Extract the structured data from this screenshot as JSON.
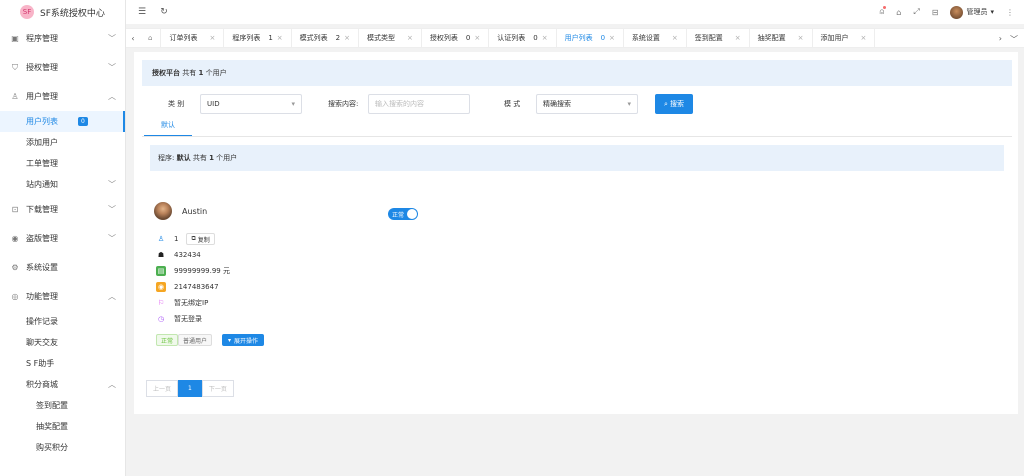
{
  "app": {
    "title": "SF系统授权中心",
    "logo_icon": "SF"
  },
  "colors": {
    "accent": "#1e88e5",
    "notice_bg": "#e8f1fb"
  },
  "sidebar": {
    "menus": [
      {
        "label": "程序管理",
        "icon": "app-icon",
        "arrow": "﹀"
      },
      {
        "label": "授权管理",
        "icon": "shield-icon",
        "arrow": "﹀"
      },
      {
        "label": "用户管理",
        "icon": "user-icon",
        "arrow": "︿"
      }
    ],
    "user_subs": [
      {
        "label": "用户列表",
        "count": "0"
      },
      {
        "label": "添加用户"
      },
      {
        "label": "工单管理"
      },
      {
        "label": "站内通知",
        "arrow": "﹀"
      }
    ],
    "menus2": [
      {
        "label": "下载管理",
        "icon": "download-icon",
        "arrow": "﹀"
      },
      {
        "label": "盗版管理",
        "icon": "pirate-icon",
        "arrow": "﹀"
      },
      {
        "label": "系统设置",
        "icon": "gear-icon"
      },
      {
        "label": "功能管理",
        "icon": "function-icon",
        "arrow": "︿"
      }
    ],
    "func_subs": [
      {
        "label": "操作记录"
      },
      {
        "label": "聊天交友"
      },
      {
        "label": "S F助手"
      },
      {
        "label": "积分商城",
        "arrow": "︿"
      }
    ],
    "mall_subs": [
      {
        "label": "签到配置"
      },
      {
        "label": "抽奖配置"
      },
      {
        "label": "购买积分"
      }
    ]
  },
  "topbar": {
    "menu_icon": "☰",
    "refresh_icon": "↻",
    "admin_label": "管理员"
  },
  "tabs": [
    {
      "label": "订单列表",
      "count": ""
    },
    {
      "label": "程序列表",
      "count": "1"
    },
    {
      "label": "模式列表",
      "count": "2"
    },
    {
      "label": "模式类型",
      "count": ""
    },
    {
      "label": "授权列表",
      "count": "0"
    },
    {
      "label": "认证列表",
      "count": "0"
    },
    {
      "label": "用户列表",
      "count": "0",
      "active": true
    },
    {
      "label": "系统设置",
      "count": ""
    },
    {
      "label": "签到配置",
      "count": ""
    },
    {
      "label": "抽奖配置",
      "count": ""
    },
    {
      "label": "添加用户",
      "count": ""
    }
  ],
  "notice_top": {
    "prefix": "授权平台",
    "text": "共有",
    "count": "1",
    "suffix": "个用户"
  },
  "filters": {
    "category_label": "类 别",
    "category_value": "UID",
    "search_label": "搜索内容:",
    "search_placeholder": "输入搜索的内容",
    "mode_label": "模 式",
    "mode_value": "精确搜索",
    "search_button": "搜索"
  },
  "subtab": {
    "label": "默认"
  },
  "notice_prog": {
    "prefix": "程序:",
    "name": "默认",
    "text": "共有",
    "count": "1",
    "suffix": "个用户"
  },
  "user": {
    "name": "Austin",
    "status_toggle": "正常",
    "uid": "1",
    "copy_label": "复制",
    "qq": "432434",
    "balance": "99999999.99 元",
    "points": "2147483647",
    "ip": "暂无绑定IP",
    "last_login": "暂无登录",
    "tags": [
      "正常",
      "普通用户"
    ],
    "expand_label": "展开操作"
  },
  "pagination": {
    "prev": "上一页",
    "current": "1",
    "next": "下一页"
  }
}
